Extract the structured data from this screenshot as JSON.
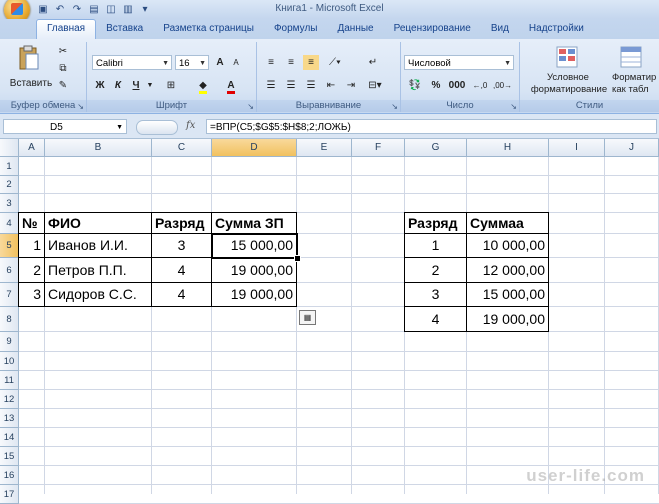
{
  "window": {
    "title": "Книга1 - Microsoft Excel"
  },
  "ribbon": {
    "tabs": [
      "Главная",
      "Вставка",
      "Разметка страницы",
      "Формулы",
      "Данные",
      "Рецензирование",
      "Вид",
      "Надстройки"
    ],
    "clipboard": {
      "paste_label": "Вставить",
      "group_label": "Буфер обмена"
    },
    "font": {
      "name": "Calibri",
      "size": "16",
      "bold": "Ж",
      "italic": "К",
      "underline": "Ч",
      "group_label": "Шрифт"
    },
    "alignment": {
      "group_label": "Выравнивание"
    },
    "number": {
      "format": "Числовой",
      "group_label": "Число"
    },
    "styles": {
      "conditional_line1": "Условное",
      "conditional_line2": "форматирование",
      "table_line1": "Форматир",
      "table_line2": "как табл",
      "group_label": "Стили"
    }
  },
  "formula_bar": {
    "name_box": "D5",
    "fx": "fx",
    "formula": "=ВПР(C5;$G$5:$H$8;2;ЛОЖЬ)"
  },
  "sheet": {
    "columns": [
      "A",
      "B",
      "C",
      "D",
      "E",
      "F",
      "G",
      "H",
      "I",
      "J"
    ],
    "selected_column": "D",
    "rows": [
      "1",
      "2",
      "3",
      "4",
      "5",
      "6",
      "7",
      "8",
      "9",
      "10",
      "11",
      "12",
      "13",
      "14",
      "15",
      "16",
      "17"
    ],
    "selected_row": "5",
    "table1": {
      "headers": [
        "№",
        "ФИО",
        "Разряд",
        "Сумма ЗП"
      ],
      "rows": [
        [
          "1",
          "Иванов И.И.",
          "3",
          "15 000,00"
        ],
        [
          "2",
          "Петров П.П.",
          "4",
          "19 000,00"
        ],
        [
          "3",
          "Сидоров С.С.",
          "4",
          "19 000,00"
        ]
      ]
    },
    "table2": {
      "headers": [
        "Разряд",
        "Суммаа"
      ],
      "rows": [
        [
          "1",
          "10 000,00"
        ],
        [
          "2",
          "12 000,00"
        ],
        [
          "3",
          "15 000,00"
        ],
        [
          "4",
          "19 000,00"
        ]
      ]
    }
  },
  "watermark": "user-life.com"
}
